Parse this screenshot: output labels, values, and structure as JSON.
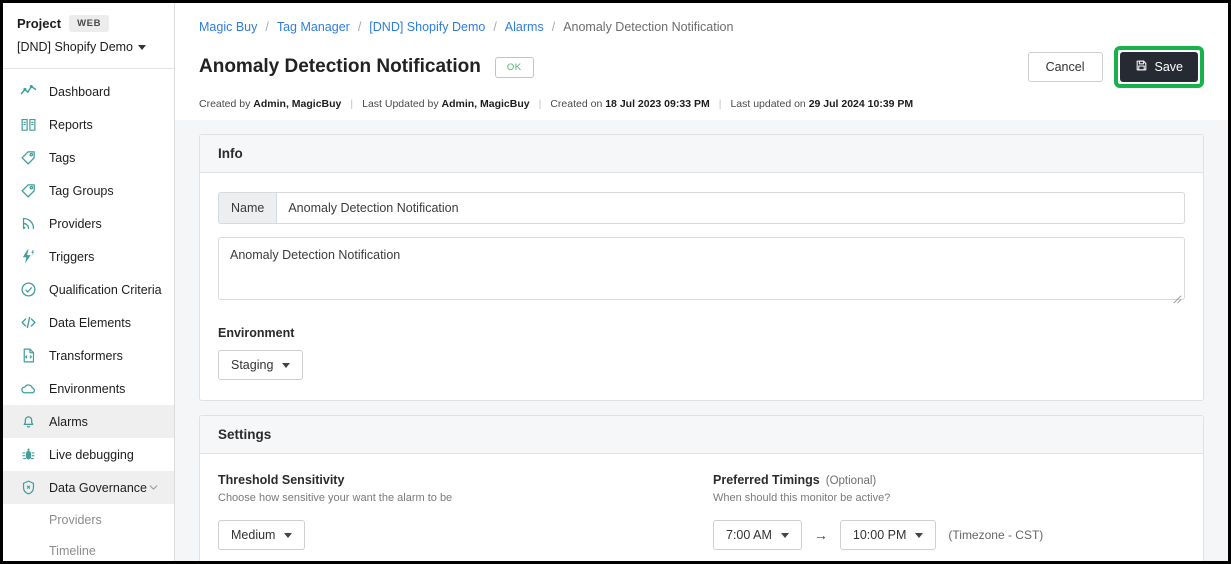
{
  "sidebar": {
    "project_label": "Project",
    "project_badge": "WEB",
    "project_name": "[DND] Shopify Demo",
    "items": [
      {
        "label": "Dashboard",
        "icon": "line-chart-icon",
        "active": false
      },
      {
        "label": "Reports",
        "icon": "book-icon",
        "active": false
      },
      {
        "label": "Tags",
        "icon": "tag-icon",
        "active": false
      },
      {
        "label": "Tag Groups",
        "icon": "tag-icon",
        "active": false
      },
      {
        "label": "Providers",
        "icon": "broadcast-icon",
        "active": false
      },
      {
        "label": "Triggers",
        "icon": "bolt-icon",
        "active": false
      },
      {
        "label": "Qualification Criteria",
        "icon": "check-circle-icon",
        "active": false
      },
      {
        "label": "Data Elements",
        "icon": "code-icon",
        "active": false
      },
      {
        "label": "Transformers",
        "icon": "file-code-icon",
        "active": false
      },
      {
        "label": "Environments",
        "icon": "cloud-icon",
        "active": false
      },
      {
        "label": "Alarms",
        "icon": "bell-icon",
        "active": true
      },
      {
        "label": "Live debugging",
        "icon": "bug-icon",
        "active": false
      },
      {
        "label": "Data Governance",
        "icon": "shield-icon",
        "active": true,
        "expandable": true
      }
    ],
    "sub_items": [
      {
        "label": "Providers"
      },
      {
        "label": "Timeline"
      }
    ]
  },
  "breadcrumb": [
    {
      "label": "Magic Buy",
      "link": true
    },
    {
      "label": "Tag Manager",
      "link": true
    },
    {
      "label": "[DND] Shopify Demo",
      "link": true
    },
    {
      "label": "Alarms",
      "link": true
    },
    {
      "label": "Anomaly Detection Notification",
      "link": false
    }
  ],
  "header": {
    "title": "Anomaly Detection Notification",
    "status_badge": "OK",
    "cancel_label": "Cancel",
    "save_label": "Save",
    "save_icon": "floppy-disk-icon",
    "highlight_color": "#18b24b"
  },
  "meta": {
    "created_by_label": "Created by",
    "created_by_value": "Admin, MagicBuy",
    "updated_by_label": "Last Updated by",
    "updated_by_value": "Admin, MagicBuy",
    "created_on_label": "Created on",
    "created_on_value": "18 Jul 2023 09:33 PM",
    "updated_on_label": "Last updated on",
    "updated_on_value": "29 Jul 2024 10:39 PM"
  },
  "info_card": {
    "title": "Info",
    "name_addon": "Name",
    "name_value": "Anomaly Detection Notification",
    "name_placeholder": "Name",
    "description_value": "Anomaly Detection Notification",
    "description_placeholder": "Description",
    "environment_label": "Environment",
    "environment_value": "Staging"
  },
  "settings_card": {
    "title": "Settings",
    "threshold_label": "Threshold Sensitivity",
    "threshold_sub": "Choose how sensitive your want the alarm to be",
    "threshold_value": "Medium",
    "timings_label": "Preferred Timings",
    "timings_optional": "(Optional)",
    "timings_sub": "When should this monitor be active?",
    "time_start": "7:00 AM",
    "time_arrow": "→",
    "time_end": "10:00 PM",
    "timezone_note": "(Timezone - CST)"
  }
}
